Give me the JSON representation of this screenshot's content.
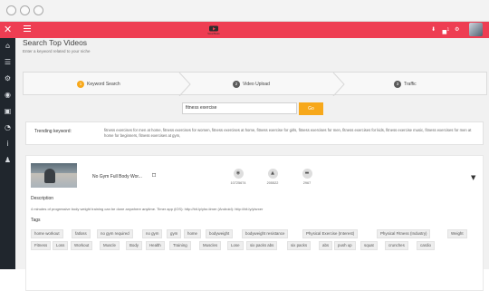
{
  "header": {
    "brand": "SaverBeats",
    "close_glyph": "✕",
    "notification_count": "1"
  },
  "page": {
    "title": "Search Top Videos",
    "subtitle": "Enter a keyword related to your niche"
  },
  "steps": [
    {
      "number": "1",
      "label": "Keyword Search"
    },
    {
      "number": "2",
      "label": "Video Upload"
    },
    {
      "number": "3",
      "label": "Traffic"
    }
  ],
  "search": {
    "value": "fitness exercise",
    "go_label": "Go"
  },
  "trending": {
    "label": "Trending keyword:",
    "text": "fitness exercises for men at home, fitness exercises for women, fitness exercises at home, fitness exercise for girls, fitness exercises for men, fitness exercises for kids, fitness exercise music, fitness exercises for men at home for beginners, fitness exercises at gym,"
  },
  "video": {
    "title": "No Gym Full Body Wor...",
    "views": "10725674",
    "likes": "205522",
    "comments": "2967",
    "description_label": "Description",
    "description": "4 minutes of progressive body weight training can be done anywhere anytime. Timer app (iOS): http://bit.ly/ylsr-timer (Android): http://bit.ly/ylsrxer",
    "tags_label": "Tags",
    "tags_row1": [
      "home workout",
      "fatloss",
      "no gym required",
      "no gym",
      "gym",
      "home",
      "bodyweight",
      "bodyweight resistance",
      "Physical Exercise (Interest)",
      "Physical Fitness (Industry)",
      "Weight"
    ],
    "tags_row2": [
      "Fitness",
      "Loss",
      "Workout",
      "Muscle",
      "Body",
      "Health",
      "Training",
      "Muscles",
      "Lose",
      "six packs abs",
      "six packs",
      "abs",
      "push up",
      "squat",
      "crunches",
      "cardio"
    ]
  },
  "colors": {
    "topbar": "#ee3d52",
    "sidebar": "#20262d",
    "active_step": "#f7a81b",
    "inactive_step": "#5a5a5a",
    "go_button": "#f7a81b"
  },
  "icons": {
    "sidebar": [
      "home-icon",
      "list-icon",
      "gear-icon",
      "globe-icon",
      "media-icon",
      "chart-icon",
      "info-icon",
      "users-icon"
    ],
    "topbar": [
      "download-icon",
      "bell-icon",
      "settings-icon"
    ]
  }
}
